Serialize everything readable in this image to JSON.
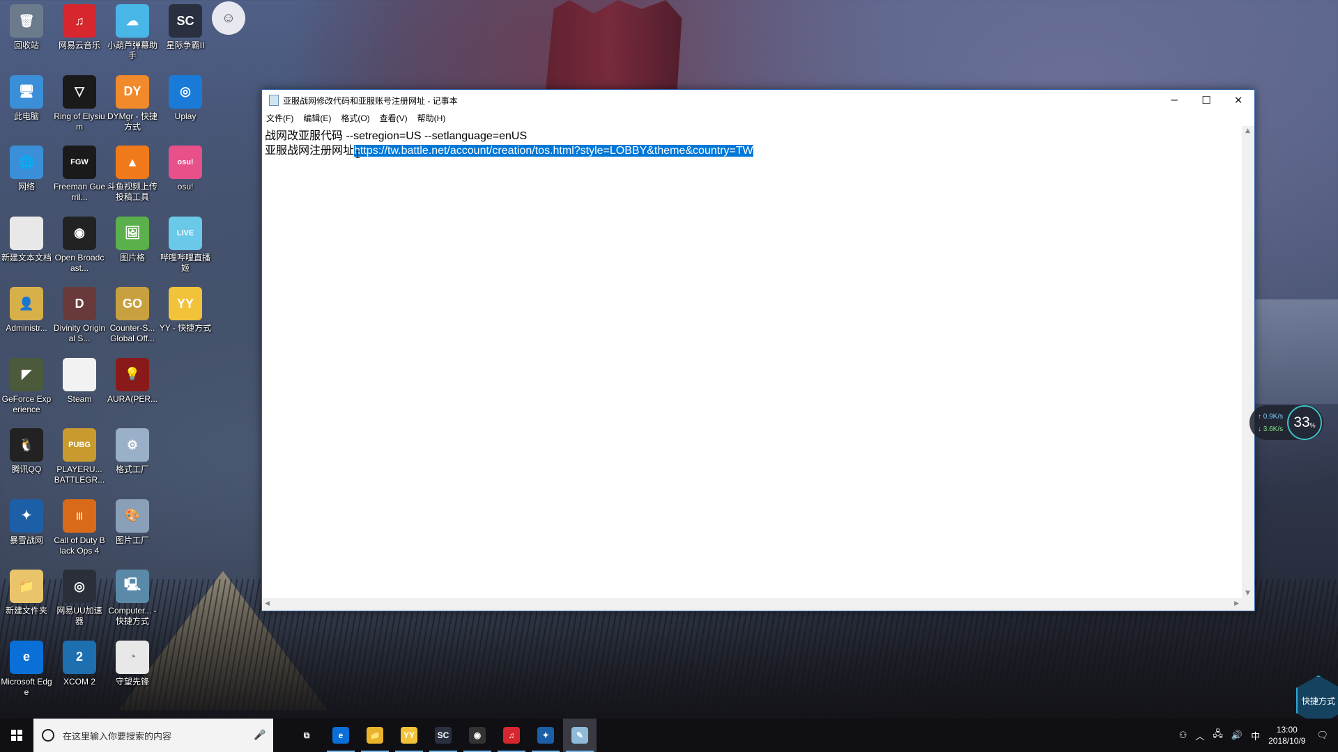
{
  "desktop": {
    "icons": [
      {
        "label": "回收站",
        "color": "#6b7b8c",
        "glyph": "🗑",
        "col": 0,
        "row": 0
      },
      {
        "label": "此电脑",
        "color": "#3a8fd8",
        "glyph": "🖥",
        "col": 0,
        "row": 1
      },
      {
        "label": "网络",
        "color": "#3a8fd8",
        "glyph": "🌐",
        "col": 0,
        "row": 2
      },
      {
        "label": "新建文本文档",
        "color": "#e8e8e8",
        "glyph": "",
        "col": 0,
        "row": 3
      },
      {
        "label": "Administr...",
        "color": "#d8b04a",
        "glyph": "👤",
        "col": 0,
        "row": 4
      },
      {
        "label": "GeForce Experience",
        "color": "#4a5a3a",
        "glyph": "◤",
        "col": 0,
        "row": 5
      },
      {
        "label": "腾讯QQ",
        "color": "#222",
        "glyph": "🐧",
        "col": 0,
        "row": 6
      },
      {
        "label": "暴雪战网",
        "color": "#1d5fa6",
        "glyph": "✦",
        "col": 0,
        "row": 7
      },
      {
        "label": "新建文件夹",
        "color": "#e9c46a",
        "glyph": "📁",
        "col": 0,
        "row": 8
      },
      {
        "label": "Microsoft Edge",
        "color": "#0a6fd6",
        "glyph": "e",
        "col": 0,
        "row": 9
      },
      {
        "label": "网易云音乐",
        "color": "#d7262e",
        "glyph": "♫",
        "col": 1,
        "row": 0
      },
      {
        "label": "Ring of Elysium",
        "color": "#1a1a1a",
        "glyph": "▽",
        "col": 1,
        "row": 1
      },
      {
        "label": "Freeman Guerril...",
        "color": "#1a1a1a",
        "glyph": "FGW",
        "col": 1,
        "row": 2
      },
      {
        "label": "Open Broadcast...",
        "color": "#222",
        "glyph": "◉",
        "col": 1,
        "row": 3
      },
      {
        "label": "Divinity Original S...",
        "color": "#6a3a3a",
        "glyph": "D",
        "col": 1,
        "row": 4
      },
      {
        "label": "Steam",
        "color": "#f2f2f2",
        "glyph": "",
        "col": 1,
        "row": 5
      },
      {
        "label": "PLAYERU... BATTLEGR...",
        "color": "#c99a2e",
        "glyph": "PUBG",
        "col": 1,
        "row": 6
      },
      {
        "label": "Call of Duty Black Ops 4",
        "color": "#d86a1a",
        "glyph": "|||",
        "col": 1,
        "row": 7
      },
      {
        "label": "网易UU加速器",
        "color": "#2a2f3a",
        "glyph": "◎",
        "col": 1,
        "row": 8
      },
      {
        "label": "XCOM 2",
        "color": "#1d6fb0",
        "glyph": "2",
        "col": 1,
        "row": 9
      },
      {
        "label": "小葫芦弹幕助手",
        "color": "#49b6e8",
        "glyph": "☁",
        "col": 2,
        "row": 0
      },
      {
        "label": "DYMgr - 快捷方式",
        "color": "#f08a2a",
        "glyph": "DY",
        "col": 2,
        "row": 1
      },
      {
        "label": "斗鱼视频上传投稿工具",
        "color": "#f07a1a",
        "glyph": "▲",
        "col": 2,
        "row": 2
      },
      {
        "label": "图片格",
        "color": "#5ab04a",
        "glyph": "🖼",
        "col": 2,
        "row": 3
      },
      {
        "label": "Counter-S... Global Off...",
        "color": "#c8a040",
        "glyph": "GO",
        "col": 2,
        "row": 4
      },
      {
        "label": "AURA(PER...",
        "color": "#8a1a1a",
        "glyph": "💡",
        "col": 2,
        "row": 5
      },
      {
        "label": "格式工厂",
        "color": "#9ab0c8",
        "glyph": "⚙",
        "col": 2,
        "row": 6
      },
      {
        "label": "图片工厂",
        "color": "#8aa0b8",
        "glyph": "🎨",
        "col": 2,
        "row": 7
      },
      {
        "label": "Computer... - 快捷方式",
        "color": "#5a8aa8",
        "glyph": "🖳",
        "col": 2,
        "row": 8
      },
      {
        "label": "守望先锋",
        "color": "#e8e8e8",
        "glyph": "◔",
        "col": 2,
        "row": 9
      },
      {
        "label": "星际争霸II",
        "color": "#2a3040",
        "glyph": "SC",
        "col": 3,
        "row": 0
      },
      {
        "label": "Uplay",
        "color": "#1a7ad8",
        "glyph": "◎",
        "col": 3,
        "row": 1
      },
      {
        "label": "osu!",
        "color": "#e8508a",
        "glyph": "osu!",
        "col": 3,
        "row": 2
      },
      {
        "label": "哔哩哔哩直播姬",
        "color": "#6ac8e8",
        "glyph": "LIVE",
        "col": 3,
        "row": 3
      },
      {
        "label": "YY - 快捷方式",
        "color": "#f2c23a",
        "glyph": "YY",
        "col": 3,
        "row": 4
      }
    ]
  },
  "notepad": {
    "title": "亚服战网修改代码和亚服账号注册网址 - 记事本",
    "menu": [
      "文件(F)",
      "编辑(E)",
      "格式(O)",
      "查看(V)",
      "帮助(H)"
    ],
    "line1": "战网改亚服代码 --setregion=US --setlanguage=enUS",
    "line2_prefix": "亚服战网注册网址",
    "line2_selected": "https://tw.battle.net/account/creation/tos.html?style=LOBBY&theme&country=TW",
    "minimize": "─",
    "maximize": "☐",
    "close": "✕"
  },
  "network_widget": {
    "upload": "↑ 0.9K/s",
    "download": "↓ 3.6K/s",
    "percent": "33",
    "percent_unit": "%"
  },
  "quick_shortcut": "快捷方式",
  "taskbar": {
    "search_placeholder": "在这里输入你要搜索的内容",
    "apps": [
      {
        "name": "task-view",
        "glyph": "⧉",
        "color": "transparent"
      },
      {
        "name": "edge",
        "glyph": "e",
        "color": "#0a6fd6"
      },
      {
        "name": "file-explorer",
        "glyph": "📁",
        "color": "#e9b32a"
      },
      {
        "name": "yy",
        "glyph": "YY",
        "color": "#f2c23a"
      },
      {
        "name": "starcraft",
        "glyph": "SC",
        "color": "#2a3040"
      },
      {
        "name": "obs",
        "glyph": "◉",
        "color": "#333"
      },
      {
        "name": "netease-music",
        "glyph": "♫",
        "color": "#d7262e"
      },
      {
        "name": "battle-net",
        "glyph": "✦",
        "color": "#1d5fa6"
      },
      {
        "name": "notepad",
        "glyph": "✎",
        "color": "#8fbad8"
      }
    ],
    "tray_ime": "中",
    "time": "13:00",
    "date": "2018/10/9"
  }
}
